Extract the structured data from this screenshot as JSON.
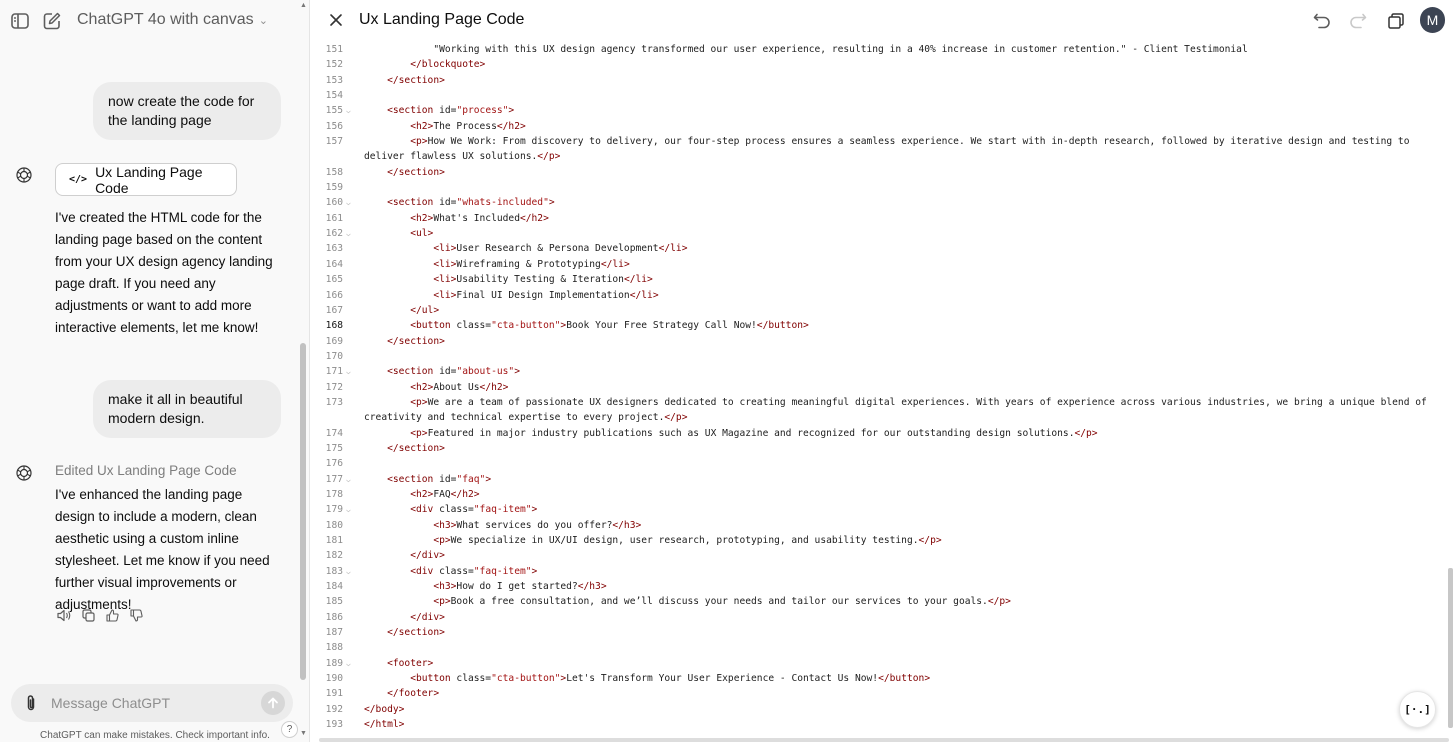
{
  "header": {
    "model_name": "ChatGPT 4o with canvas"
  },
  "chat": {
    "user_messages": [
      "now create the code for the landing page",
      "make it all in beautiful modern design."
    ],
    "canvas_chip_label": "Ux Landing Page Code",
    "assistant_messages": [
      "I've created the HTML code for the landing page based on the content from your UX design agency landing page draft. If you need any adjustments or want to add more interactive elements, let me know!",
      "I've enhanced the landing page design to include a modern, clean aesthetic using a custom inline stylesheet. Let me know if you need further visual improvements or adjustments!"
    ],
    "edited_label": "Edited Ux Landing Page Code"
  },
  "composer": {
    "placeholder": "Message ChatGPT",
    "disclaimer": "ChatGPT can make mistakes. Check important info.",
    "help": "?"
  },
  "canvas": {
    "title": "Ux Landing Page Code",
    "avatar_initial": "M",
    "active_line": 168,
    "lines": [
      {
        "n": 151,
        "text": "            \"Working with this UX design agency transformed our user experience, resulting in a 40% increase in customer retention.\" - Client Testimonial"
      },
      {
        "n": 152,
        "text": "        </blockquote>"
      },
      {
        "n": 153,
        "text": "    </section>"
      },
      {
        "n": 154,
        "text": ""
      },
      {
        "n": 155,
        "text": "    <section id=\"process\">",
        "fold": true
      },
      {
        "n": 156,
        "text": "        <h2>The Process</h2>"
      },
      {
        "n": 157,
        "text": "        <p>How We Work: From discovery to delivery, our four-step process ensures a seamless experience. We start with in-depth research, followed by iterative design and testing to deliver flawless UX solutions.</p>",
        "wrap": true
      },
      {
        "n": 158,
        "text": "    </section>"
      },
      {
        "n": 159,
        "text": ""
      },
      {
        "n": 160,
        "text": "    <section id=\"whats-included\">",
        "fold": true
      },
      {
        "n": 161,
        "text": "        <h2>What's Included</h2>"
      },
      {
        "n": 162,
        "text": "        <ul>",
        "fold": true
      },
      {
        "n": 163,
        "text": "            <li>User Research & Persona Development</li>"
      },
      {
        "n": 164,
        "text": "            <li>Wireframing & Prototyping</li>"
      },
      {
        "n": 165,
        "text": "            <li>Usability Testing & Iteration</li>"
      },
      {
        "n": 166,
        "text": "            <li>Final UI Design Implementation</li>"
      },
      {
        "n": 167,
        "text": "        </ul>"
      },
      {
        "n": 168,
        "text": "        <button class=\"cta-button\">Book Your Free Strategy Call Now!</button>"
      },
      {
        "n": 169,
        "text": "    </section>"
      },
      {
        "n": 170,
        "text": ""
      },
      {
        "n": 171,
        "text": "    <section id=\"about-us\">",
        "fold": true
      },
      {
        "n": 172,
        "text": "        <h2>About Us</h2>"
      },
      {
        "n": 173,
        "text": "        <p>We are a team of passionate UX designers dedicated to creating meaningful digital experiences. With years of experience across various industries, we bring a unique blend of creativity and technical expertise to every project.</p>",
        "wrap": true
      },
      {
        "n": 174,
        "text": "        <p>Featured in major industry publications such as UX Magazine and recognized for our outstanding design solutions.</p>"
      },
      {
        "n": 175,
        "text": "    </section>"
      },
      {
        "n": 176,
        "text": ""
      },
      {
        "n": 177,
        "text": "    <section id=\"faq\">",
        "fold": true
      },
      {
        "n": 178,
        "text": "        <h2>FAQ</h2>"
      },
      {
        "n": 179,
        "text": "        <div class=\"faq-item\">",
        "fold": true
      },
      {
        "n": 180,
        "text": "            <h3>What services do you offer?</h3>"
      },
      {
        "n": 181,
        "text": "            <p>We specialize in UX/UI design, user research, prototyping, and usability testing.</p>"
      },
      {
        "n": 182,
        "text": "        </div>"
      },
      {
        "n": 183,
        "text": "        <div class=\"faq-item\">",
        "fold": true
      },
      {
        "n": 184,
        "text": "            <h3>How do I get started?</h3>"
      },
      {
        "n": 185,
        "text": "            <p>Book a free consultation, and we’ll discuss your needs and tailor our services to your goals.</p>"
      },
      {
        "n": 186,
        "text": "        </div>"
      },
      {
        "n": 187,
        "text": "    </section>"
      },
      {
        "n": 188,
        "text": ""
      },
      {
        "n": 189,
        "text": "    <footer>",
        "fold": true
      },
      {
        "n": 190,
        "text": "        <button class=\"cta-button\">Let's Transform Your User Experience - Contact Us Now!</button>"
      },
      {
        "n": 191,
        "text": "    </footer>"
      },
      {
        "n": 192,
        "text": "</body>"
      },
      {
        "n": 193,
        "text": "</html>"
      }
    ]
  },
  "colors": {
    "sidebar_bg": "#f9f9f9",
    "tag": "#800000",
    "string": "#a31515",
    "line_number": "#8c8c8c",
    "avatar_bg": "#3c4453"
  },
  "icons": [
    "sidebar-toggle-icon",
    "new-chat-icon",
    "chevron-down-icon",
    "openai-logo-icon",
    "code-icon",
    "speaker-icon",
    "copy-icon",
    "thumbs-up-icon",
    "thumbs-down-icon",
    "paperclip-icon",
    "arrow-up-icon",
    "close-icon",
    "undo-icon",
    "redo-icon",
    "version-history-icon",
    "code-review-icon"
  ]
}
